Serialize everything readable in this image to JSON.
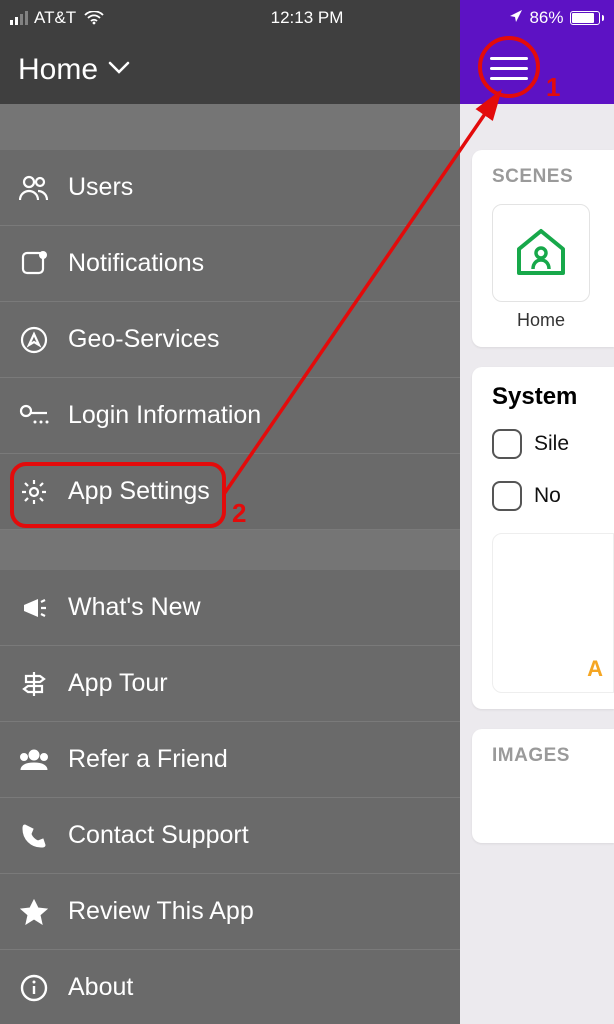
{
  "status": {
    "carrier": "AT&T",
    "time": "12:13 PM",
    "battery_pct": "86%"
  },
  "nav": {
    "title": "Home"
  },
  "menu": {
    "group1": [
      {
        "label": "Users",
        "icon": "users-icon"
      },
      {
        "label": "Notifications",
        "icon": "notification-icon"
      },
      {
        "label": "Geo-Services",
        "icon": "compass-icon"
      },
      {
        "label": "Login Information",
        "icon": "key-icon"
      },
      {
        "label": "App Settings",
        "icon": "gear-icon"
      }
    ],
    "group2": [
      {
        "label": "What's New",
        "icon": "megaphone-icon"
      },
      {
        "label": "App Tour",
        "icon": "signpost-icon"
      },
      {
        "label": "Refer a Friend",
        "icon": "group-icon"
      },
      {
        "label": "Contact Support",
        "icon": "phone-icon"
      },
      {
        "label": "Review This App",
        "icon": "star-icon"
      },
      {
        "label": "About",
        "icon": "info-icon"
      }
    ]
  },
  "peek": {
    "scenes_header": "SCENES",
    "scene_label": "Home",
    "system_header": "System",
    "sys_opt1": "Sile",
    "sys_opt2": "No",
    "accent_text": "A",
    "images_header": "IMAGES"
  },
  "annotations": {
    "num1": "1",
    "num2": "2"
  },
  "colors": {
    "purple": "#5d12c4",
    "annotation_red": "#e30b0b",
    "scene_green": "#17a84a"
  }
}
